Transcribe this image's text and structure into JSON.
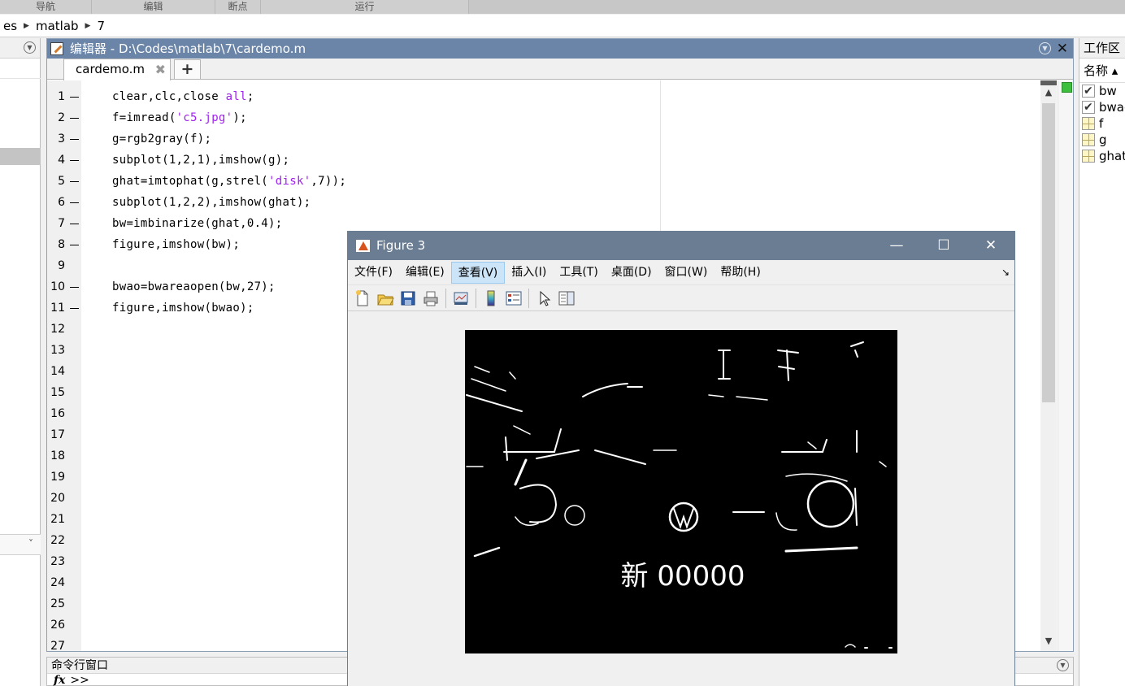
{
  "toolstrip": {
    "sections": [
      "导航",
      "编辑",
      "断点",
      "运行"
    ]
  },
  "address": {
    "segments": [
      "es",
      "matlab",
      "7"
    ]
  },
  "editor": {
    "title": "编辑器 - D:\\Codes\\matlab\\7\\cardemo.m",
    "tab_label": "cardemo.m",
    "tab_close": "✖",
    "tab_add": "+",
    "lines": [
      {
        "n": "1",
        "dash": true,
        "code": [
          [
            "t",
            "clear,clc,close "
          ],
          [
            "s",
            "all"
          ],
          [
            "t",
            ";"
          ]
        ]
      },
      {
        "n": "2",
        "dash": true,
        "code": [
          [
            "t",
            "f=imread("
          ],
          [
            "s",
            "'c5.jpg'"
          ],
          [
            "t",
            ");"
          ]
        ]
      },
      {
        "n": "3",
        "dash": true,
        "code": [
          [
            "t",
            "g=rgb2gray(f);"
          ]
        ]
      },
      {
        "n": "4",
        "dash": true,
        "code": [
          [
            "t",
            "subplot(1,2,1),imshow(g);"
          ]
        ]
      },
      {
        "n": "5",
        "dash": true,
        "code": [
          [
            "t",
            "ghat=imtophat(g,strel("
          ],
          [
            "s",
            "'disk'"
          ],
          [
            "t",
            ",7));"
          ]
        ]
      },
      {
        "n": "6",
        "dash": true,
        "code": [
          [
            "t",
            "subplot(1,2,2),imshow(ghat);"
          ]
        ]
      },
      {
        "n": "7",
        "dash": true,
        "code": [
          [
            "t",
            "bw=imbinarize(ghat,0.4);"
          ]
        ]
      },
      {
        "n": "8",
        "dash": true,
        "code": [
          [
            "t",
            "figure,imshow(bw);"
          ]
        ]
      },
      {
        "n": "9",
        "dash": false,
        "code": []
      },
      {
        "n": "10",
        "dash": true,
        "code": [
          [
            "t",
            "bwao=bwareaopen(bw,27);"
          ]
        ]
      },
      {
        "n": "11",
        "dash": true,
        "code": [
          [
            "t",
            "figure,imshow(bwao);"
          ]
        ]
      },
      {
        "n": "12",
        "dash": false,
        "code": []
      },
      {
        "n": "13",
        "dash": false,
        "code": []
      },
      {
        "n": "14",
        "dash": false,
        "code": []
      },
      {
        "n": "15",
        "dash": false,
        "code": []
      },
      {
        "n": "16",
        "dash": false,
        "code": []
      },
      {
        "n": "17",
        "dash": false,
        "code": []
      },
      {
        "n": "18",
        "dash": false,
        "code": []
      },
      {
        "n": "19",
        "dash": false,
        "code": []
      },
      {
        "n": "20",
        "dash": false,
        "code": []
      },
      {
        "n": "21",
        "dash": false,
        "code": []
      },
      {
        "n": "22",
        "dash": false,
        "code": []
      },
      {
        "n": "23",
        "dash": false,
        "code": []
      },
      {
        "n": "24",
        "dash": false,
        "code": []
      },
      {
        "n": "25",
        "dash": false,
        "code": []
      },
      {
        "n": "26",
        "dash": false,
        "code": []
      },
      {
        "n": "27",
        "dash": false,
        "code": []
      }
    ],
    "colors": {
      "string": "#a020f0",
      "title_bar": "#6b85a8",
      "status_ok": "#3cbf3c"
    }
  },
  "command_window": {
    "title": "命令行窗口",
    "fx": "fx",
    "prompt": ">>"
  },
  "workspace": {
    "title": "工作区",
    "column_header": "名称 ▴",
    "vars": [
      {
        "name": "bw",
        "kind": "logical"
      },
      {
        "name": "bwao",
        "kind": "logical"
      },
      {
        "name": "f",
        "kind": "matrix"
      },
      {
        "name": "g",
        "kind": "matrix"
      },
      {
        "name": "ghat",
        "kind": "matrix"
      }
    ]
  },
  "figure": {
    "title": "Figure 3",
    "menu": [
      "文件(F)",
      "编辑(E)",
      "查看(V)",
      "插入(I)",
      "工具(T)",
      "桌面(D)",
      "窗口(W)",
      "帮助(H)"
    ],
    "active_menu": "查看(V)",
    "plate_text": "新 00000",
    "controls": {
      "minimize": "—",
      "maximize": "☐",
      "close": "✕"
    },
    "title_bar_color": "#6b7d92"
  }
}
